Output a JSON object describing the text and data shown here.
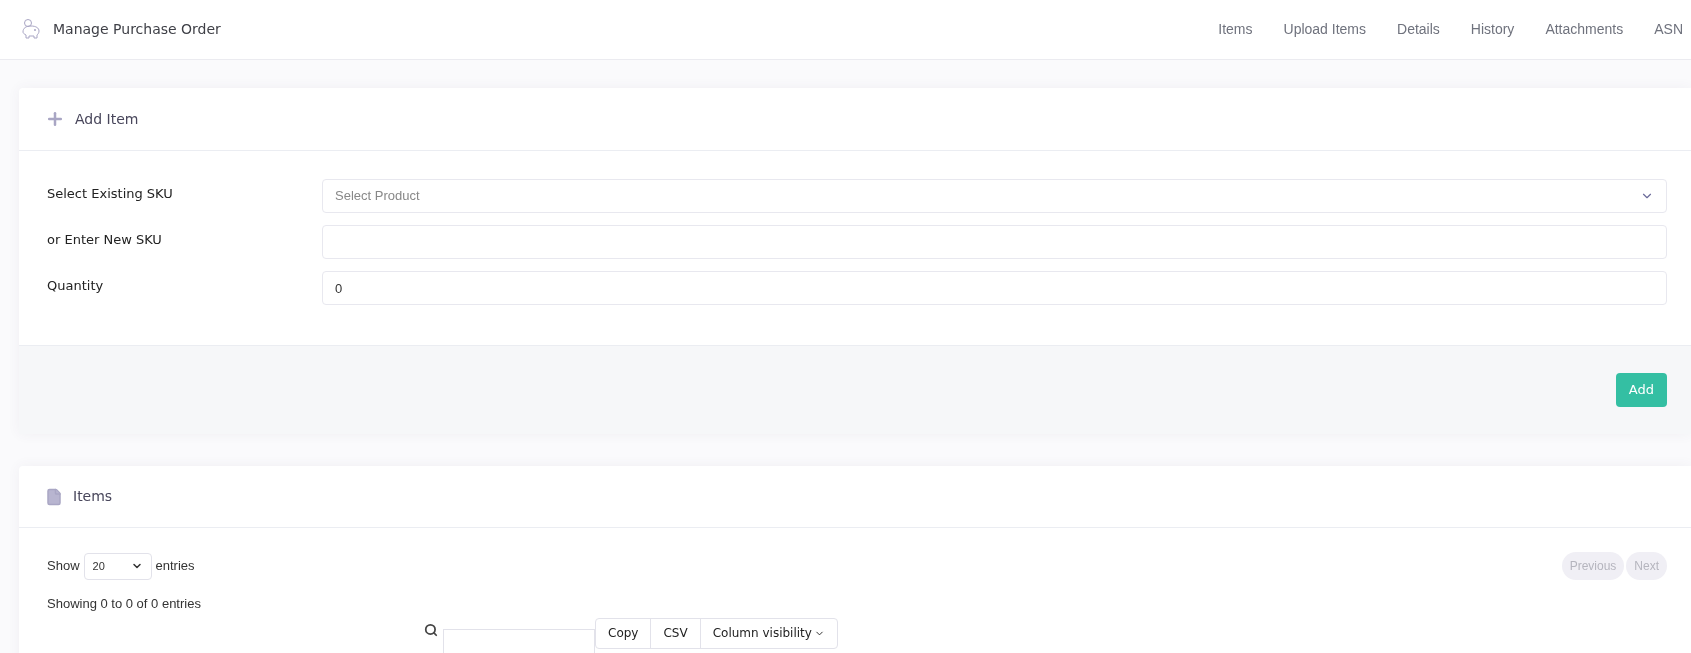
{
  "header": {
    "title": "Manage Purchase Order",
    "nav": [
      {
        "label": "Items"
      },
      {
        "label": "Upload Items"
      },
      {
        "label": "Details"
      },
      {
        "label": "History"
      },
      {
        "label": "Attachments"
      },
      {
        "label": "ASN"
      }
    ]
  },
  "add_item": {
    "title": "Add Item",
    "fields": [
      {
        "kind": "select",
        "label": "Select Existing SKU",
        "placeholder": "Select Product"
      },
      {
        "kind": "text",
        "label": "or Enter New SKU"
      },
      {
        "kind": "text",
        "label": "Quantity",
        "value": "0"
      }
    ],
    "button": "Add"
  },
  "items": {
    "title": "Items",
    "length_menu": {
      "before": "Show",
      "value": "20",
      "after": "entries"
    },
    "info": "Showing 0 to 0 of 0 entries",
    "pagination": [
      {
        "label": "Previous",
        "disabled": true
      },
      {
        "label": "Next",
        "disabled": true
      }
    ],
    "buttons": [
      {
        "label": "Copy",
        "kind": "plain"
      },
      {
        "label": "CSV",
        "kind": "plain"
      },
      {
        "label": "Column visibility",
        "kind": "dropdown"
      }
    ]
  }
}
